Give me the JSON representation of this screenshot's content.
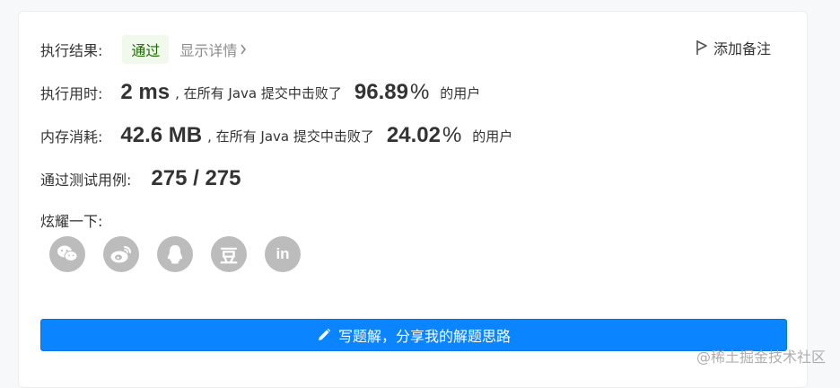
{
  "result": {
    "label": "执行结果:",
    "status": "通过",
    "details": "显示详情",
    "add_note": "添加备注"
  },
  "runtime": {
    "label": "执行用时:",
    "value": "2 ms",
    "mid_text": ", 在所有 Java 提交中击败了",
    "percent": "96.89",
    "percent_sign": "%",
    "suffix": "的用户"
  },
  "memory": {
    "label": "内存消耗:",
    "value": "42.6 MB",
    "mid_text": ", 在所有 Java 提交中击败了",
    "percent": "24.02",
    "percent_sign": "%",
    "suffix": "的用户"
  },
  "testcases": {
    "label": "通过测试用例:",
    "value": "275 / 275"
  },
  "share": {
    "label": "炫耀一下:",
    "icons": [
      "wechat-icon",
      "weibo-icon",
      "qq-icon",
      "douban-icon",
      "linkedin-icon"
    ],
    "douban_glyph": "豆",
    "linkedin_glyph": "in"
  },
  "write_button": {
    "label": "写题解，分享我的解题思路"
  },
  "watermark": {
    "text": "@稀土掘金技术社区"
  },
  "colors": {
    "primary": "#0a84ff",
    "success_bg": "#f0f9eb",
    "icon_gray": "#bcbcbc"
  }
}
